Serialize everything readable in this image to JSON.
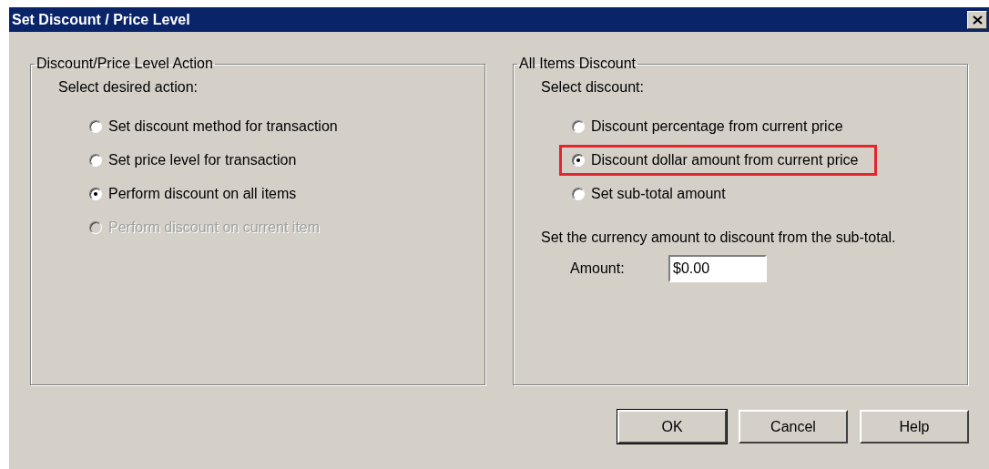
{
  "window": {
    "title": "Set Discount / Price Level"
  },
  "action_group": {
    "title": "Discount/Price Level Action",
    "prompt": "Select desired action:",
    "options": [
      {
        "label": "Set discount method for transaction",
        "selected": false,
        "disabled": false,
        "highlighted": false
      },
      {
        "label": "Set price level for transaction",
        "selected": false,
        "disabled": false,
        "highlighted": false
      },
      {
        "label": "Perform discount on all items",
        "selected": true,
        "disabled": false,
        "highlighted": false
      },
      {
        "label": "Perform discount on current item",
        "selected": false,
        "disabled": true,
        "highlighted": false
      }
    ]
  },
  "discount_group": {
    "title": "All Items Discount",
    "prompt": "Select discount:",
    "options": [
      {
        "label": "Discount percentage from current price",
        "selected": false,
        "disabled": false,
        "highlighted": false
      },
      {
        "label": "Discount dollar amount from current price",
        "selected": true,
        "disabled": false,
        "highlighted": true
      },
      {
        "label": "Set sub-total amount",
        "selected": false,
        "disabled": false,
        "highlighted": false
      }
    ],
    "description": "Set the currency amount to discount from the sub-total.",
    "amount": {
      "label": "Amount:",
      "value": "$0.00"
    }
  },
  "buttons": [
    {
      "label": "OK",
      "default": true
    },
    {
      "label": "Cancel",
      "default": false
    },
    {
      "label": "Help",
      "default": false
    }
  ]
}
